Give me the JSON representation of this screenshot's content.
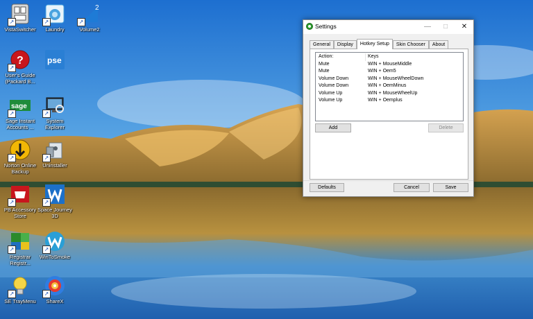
{
  "desktop": {
    "icons": [
      {
        "label": "VistaSwitcher",
        "icon": "vistaswitcher-icon",
        "color": "#c8c8c8"
      },
      {
        "label": "Laundry",
        "icon": "laundry-icon",
        "color": "#4aa3df"
      },
      {
        "label": "Volume2",
        "icon": "volume2-icon",
        "color": "#1e7bd6"
      },
      {
        "label": "User's Guide\n(Packard B...",
        "icon": "users-guide-icon",
        "color": "#c8161d"
      },
      {
        "label": "",
        "icon": "pse-icon",
        "color": "#2a7fd4"
      },
      {
        "label": "Sage Instant\nAccounts ...",
        "icon": "sage-icon",
        "color": "#1e8c3a"
      },
      {
        "label": "System\nExplorer",
        "icon": "system-explorer-icon",
        "color": "#4a6b8a"
      },
      {
        "label": "Norton Online\nBackup",
        "icon": "norton-icon",
        "color": "#f2b705"
      },
      {
        "label": "Uninstaller",
        "icon": "uninstaller-icon",
        "color": "#9aa7b2"
      },
      {
        "label": "PB Accessory\nStore",
        "icon": "pb-store-icon",
        "color": "#c8161d"
      },
      {
        "label": "Space Journey\n3D",
        "icon": "space-journey-icon",
        "color": "#1c70c8"
      },
      {
        "label": "Registrar\nRegistr...",
        "icon": "registrar-icon",
        "color": "#2b8a2b"
      },
      {
        "label": "WinToSmoke",
        "icon": "wintosmoke-icon",
        "color": "#2a9fd6"
      },
      {
        "label": "SE TrayMenu",
        "icon": "tray-menu-icon",
        "color": "#f5d547"
      },
      {
        "label": "ShareX",
        "icon": "sharex-icon",
        "color": "#2f7de1"
      }
    ],
    "pse_text": "pse",
    "sage_text": "sage",
    "volume_badge": "2"
  },
  "window": {
    "title": "Settings",
    "minimize": "—",
    "maximize": "□",
    "close": "✕",
    "tabs": [
      "General",
      "Display",
      "Hotkey Setup",
      "Skin Chooser",
      "About"
    ],
    "active_tab": "Hotkey Setup",
    "list": {
      "headers": {
        "action": "Action:",
        "keys": "Keys"
      },
      "rows": [
        {
          "action": "Mute",
          "keys": "WIN + MouseMiddle"
        },
        {
          "action": "Mute",
          "keys": "WIN + Oem5"
        },
        {
          "action": "Volume Down",
          "keys": "WIN + MouseWheelDown"
        },
        {
          "action": "Volume Down",
          "keys": "WIN + OemMinus"
        },
        {
          "action": "Volume Up",
          "keys": "WIN + MouseWheelUp"
        },
        {
          "action": "Volume Up",
          "keys": "WIN + Oemplus"
        }
      ]
    },
    "buttons": {
      "add": "Add",
      "delete": "Delete",
      "defaults": "Defaults",
      "cancel": "Cancel",
      "save": "Save"
    }
  }
}
